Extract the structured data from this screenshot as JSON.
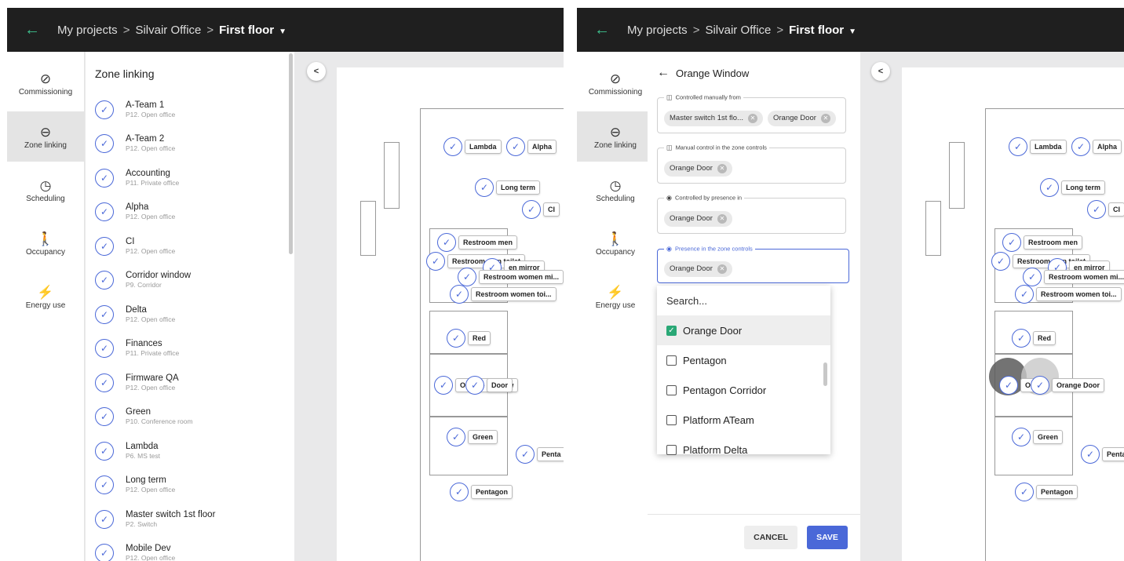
{
  "colors": {
    "accent": "#4a68d8",
    "brand_green": "#3ec28f",
    "topbar": "#1f1f1f"
  },
  "breadcrumb": {
    "root": "My projects",
    "project": "Silvair Office",
    "floor": "First floor",
    "separator": ">"
  },
  "rail": [
    {
      "label": "Commissioning",
      "icon": "check-circle-icon"
    },
    {
      "label": "Zone linking",
      "icon": "link-icon"
    },
    {
      "label": "Scheduling",
      "icon": "clock-icon"
    },
    {
      "label": "Occupancy",
      "icon": "walking-person-icon"
    },
    {
      "label": "Energy use",
      "icon": "lightning-icon"
    }
  ],
  "zone_linking": {
    "title": "Zone linking",
    "items": [
      {
        "name": "A-Team 1",
        "sub": "P12. Open office"
      },
      {
        "name": "A-Team 2",
        "sub": "P12. Open office"
      },
      {
        "name": "Accounting",
        "sub": "P11. Private office"
      },
      {
        "name": "Alpha",
        "sub": "P12. Open office"
      },
      {
        "name": "CI",
        "sub": "P12. Open office"
      },
      {
        "name": "Corridor window",
        "sub": "P9. Corridor"
      },
      {
        "name": "Delta",
        "sub": "P12. Open office"
      },
      {
        "name": "Finances",
        "sub": "P11. Private office"
      },
      {
        "name": "Firmware QA",
        "sub": "P12. Open office"
      },
      {
        "name": "Green",
        "sub": "P10. Conference room"
      },
      {
        "name": "Lambda",
        "sub": "P6. MS test"
      },
      {
        "name": "Long term",
        "sub": "P12. Open office"
      },
      {
        "name": "Master switch 1st floor",
        "sub": "P2. Switch"
      },
      {
        "name": "Mobile Dev",
        "sub": "P12. Open office"
      }
    ]
  },
  "map_left": {
    "chips": [
      "Lambda",
      "Alpha",
      "Long term",
      "CI",
      "Restroom men",
      "Restroom men toilet",
      "en mirror",
      "Restroom women mi...",
      "Restroom women toi...",
      "Red",
      "Orange Window",
      "Door",
      "Green",
      "Penta",
      "Pentagon"
    ]
  },
  "map_right": {
    "chips": [
      "Lambda",
      "Alpha",
      "Long term",
      "CI",
      "Restroom men",
      "Restroom men toilet",
      "en mirror",
      "Restroom women mi...",
      "Restroom women toi...",
      "Red",
      "O",
      "Orange Door",
      "Green",
      "Penta",
      "Pentagon"
    ]
  },
  "detail": {
    "title": "Orange Window",
    "sections": [
      {
        "legend": "Controlled manually from",
        "tags": [
          "Master switch 1st flo...",
          "Orange Door"
        ]
      },
      {
        "legend": "Manual control in the zone controls",
        "tags": [
          "Orange Door"
        ]
      },
      {
        "legend": "Controlled by presence in",
        "tags": [
          "Orange Door"
        ]
      },
      {
        "legend": "Presence in the zone controls",
        "tags": [
          "Orange Door"
        ]
      }
    ],
    "dropdown": {
      "placeholder": "Search...",
      "options": [
        {
          "label": "Orange Door",
          "checked": true
        },
        {
          "label": "Pentagon",
          "checked": false
        },
        {
          "label": "Pentagon Corridor",
          "checked": false
        },
        {
          "label": "Platform ATeam",
          "checked": false
        },
        {
          "label": "Platform Delta",
          "checked": false
        }
      ]
    },
    "cancel_label": "CANCEL",
    "save_label": "SAVE"
  }
}
